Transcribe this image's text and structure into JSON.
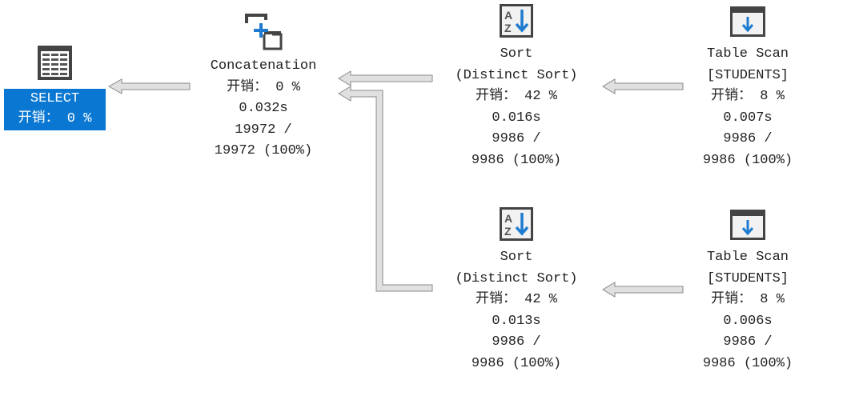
{
  "accent_color": "#0a78d2",
  "nodes": {
    "select": {
      "name": "SELECT",
      "cost": "开销： 0 %",
      "icon": "result-table-icon"
    },
    "concat": {
      "name": "Concatenation",
      "cost": "开销： 0 %",
      "time": "0.032s",
      "rows1": "19972 /",
      "rows2": "19972 (100%)",
      "icon": "concatenation-icon"
    },
    "sort1": {
      "name": "Sort",
      "sub": "(Distinct Sort)",
      "cost": "开销： 42 %",
      "time": "0.016s",
      "rows1": "9986 /",
      "rows2": "9986 (100%)",
      "icon": "sort-az-icon"
    },
    "scan1": {
      "name": "Table Scan",
      "sub": "[STUDENTS]",
      "cost": "开销： 8 %",
      "time": "0.007s",
      "rows1": "9986 /",
      "rows2": "9986 (100%)",
      "icon": "table-scan-icon"
    },
    "sort2": {
      "name": "Sort",
      "sub": "(Distinct Sort)",
      "cost": "开销： 42 %",
      "time": "0.013s",
      "rows1": "9986 /",
      "rows2": "9986 (100%)",
      "icon": "sort-az-icon"
    },
    "scan2": {
      "name": "Table Scan",
      "sub": "[STUDENTS]",
      "cost": "开销： 8 %",
      "time": "0.006s",
      "rows1": "9986 /",
      "rows2": "9986 (100%)",
      "icon": "table-scan-icon"
    }
  }
}
